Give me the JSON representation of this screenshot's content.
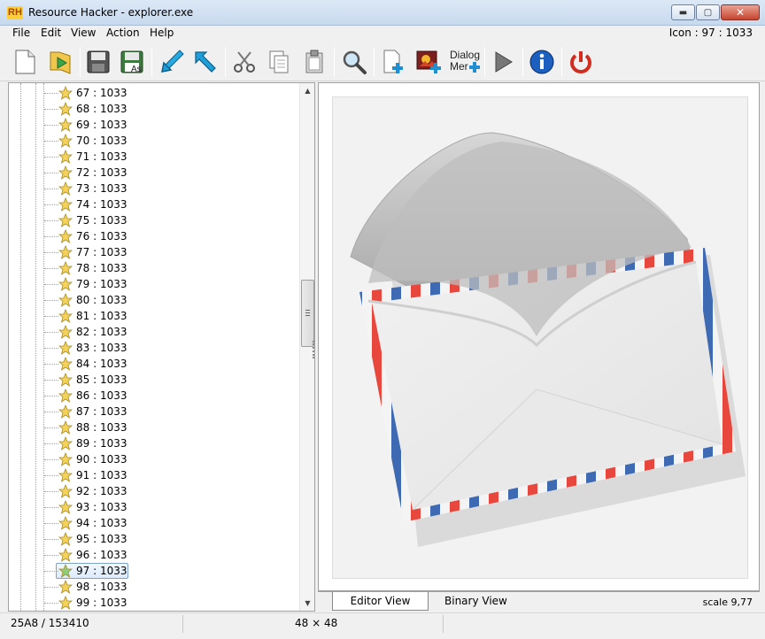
{
  "window": {
    "app_logo": "RH",
    "title": "Resource Hacker - explorer.exe",
    "controls": {
      "minimize": "▬",
      "maximize": "▢",
      "close": "✕"
    }
  },
  "menu": {
    "items": [
      "File",
      "Edit",
      "View",
      "Action",
      "Help"
    ],
    "status_right": "Icon : 97 : 1033"
  },
  "toolbar": {
    "icons": [
      "new-file-icon",
      "open-file-icon",
      "save-icon",
      "save-as-icon",
      "import-icon",
      "export-icon",
      "cut-icon",
      "copy-icon",
      "paste-icon",
      "find-icon",
      "add-blank-resource-icon",
      "add-image-resource-icon",
      "dialog-merge-icon",
      "run-icon",
      "info-icon",
      "exit-icon"
    ],
    "save_as_label": "As",
    "dialog_label_1": "Dialog",
    "dialog_label_2": "Mer"
  },
  "tree": {
    "items": [
      "67 : 1033",
      "68 : 1033",
      "69 : 1033",
      "70 : 1033",
      "71 : 1033",
      "72 : 1033",
      "73 : 1033",
      "74 : 1033",
      "75 : 1033",
      "76 : 1033",
      "77 : 1033",
      "78 : 1033",
      "79 : 1033",
      "80 : 1033",
      "81 : 1033",
      "82 : 1033",
      "83 : 1033",
      "84 : 1033",
      "85 : 1033",
      "86 : 1033",
      "87 : 1033",
      "88 : 1033",
      "89 : 1033",
      "90 : 1033",
      "91 : 1033",
      "92 : 1033",
      "93 : 1033",
      "94 : 1033",
      "95 : 1033",
      "96 : 1033",
      "97 : 1033",
      "98 : 1033",
      "99 : 1033"
    ],
    "selected": "97 : 1033",
    "scroll_up": "▲",
    "scroll_down": "▼"
  },
  "editor": {
    "tabs": {
      "editor_view": "Editor View",
      "binary_view": "Binary View"
    },
    "scale": "scale 9,77"
  },
  "status": {
    "position": "25A8 / 153410",
    "dimensions": "48 × 48"
  },
  "colors": {
    "selection_border": "#7da2ce",
    "star_fill": "#f5d35a",
    "selected_star_fill": "#8fcf7a",
    "envelope_red": "#e8473d",
    "envelope_blue": "#3e69b3"
  }
}
